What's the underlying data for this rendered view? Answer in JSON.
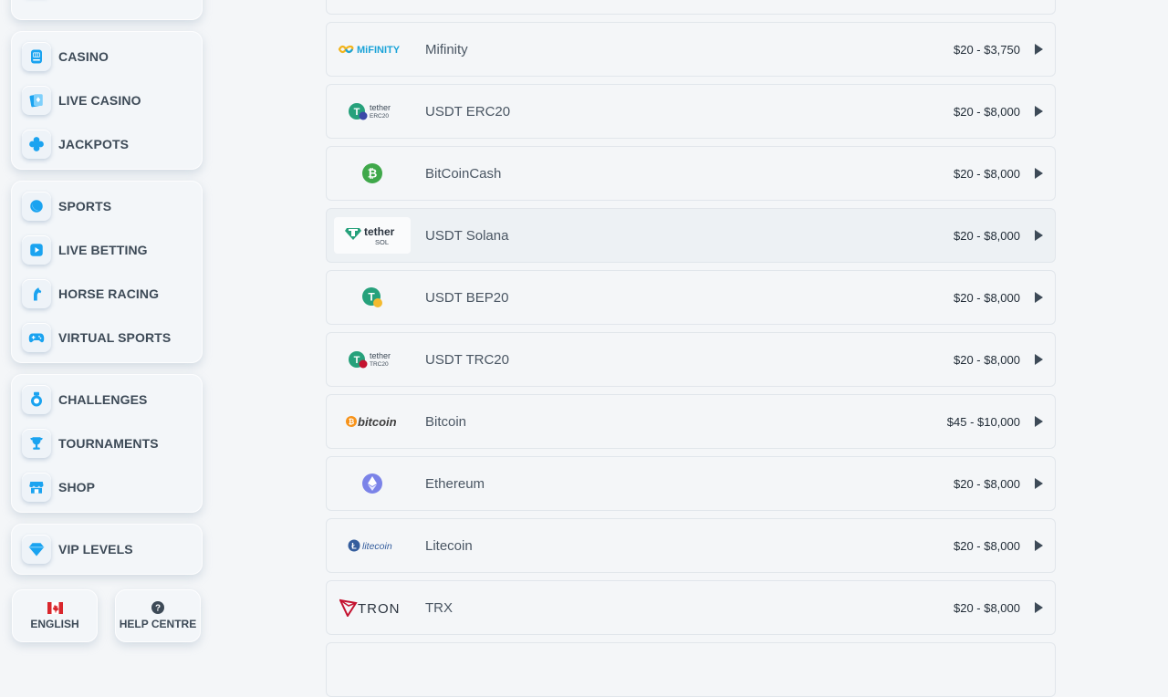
{
  "sidebar": {
    "items": [
      {
        "label": "CASINO",
        "icon": "casino-icon"
      },
      {
        "label": "LIVE CASINO",
        "icon": "live-casino-icon"
      },
      {
        "label": "JACKPOTS",
        "icon": "jackpots-icon"
      },
      {
        "label": "SPORTS",
        "icon": "sports-icon"
      },
      {
        "label": "LIVE BETTING",
        "icon": "live-betting-icon"
      },
      {
        "label": "HORSE RACING",
        "icon": "horse-racing-icon"
      },
      {
        "label": "VIRTUAL SPORTS",
        "icon": "virtual-sports-icon"
      },
      {
        "label": "CHALLENGES",
        "icon": "challenges-icon"
      },
      {
        "label": "TOURNAMENTS",
        "icon": "trophy-icon"
      },
      {
        "label": "SHOP",
        "icon": "shop-icon"
      },
      {
        "label": "VIP LEVELS",
        "icon": "diamond-icon"
      }
    ],
    "language_label": "ENGLISH",
    "help_label": "HELP CENTRE"
  },
  "payments": [
    {
      "name": "Mifinity",
      "range": "$20 - $3,750",
      "logo": "mifinity-logo",
      "logo_text": "MiFINITY"
    },
    {
      "name": "USDT ERC20",
      "range": "$20 - $8,000",
      "logo": "tether-erc20-logo",
      "logo_text": "tether",
      "logo_sub": "ERC20"
    },
    {
      "name": "BitCoinCash",
      "range": "$20 - $8,000",
      "logo": "bitcoincash-logo"
    },
    {
      "name": "USDT Solana",
      "range": "$20 - $8,000",
      "logo": "tether-sol-logo",
      "logo_text": "tether",
      "logo_sub": "SOL"
    },
    {
      "name": "USDT BEP20",
      "range": "$20 - $8,000",
      "logo": "tether-bep20-logo"
    },
    {
      "name": "USDT TRC20",
      "range": "$20 - $8,000",
      "logo": "tether-trc20-logo",
      "logo_text": "tether",
      "logo_sub": "TRC20"
    },
    {
      "name": "Bitcoin",
      "range": "$45 - $10,000",
      "logo": "bitcoin-logo",
      "logo_text": "bitcoin"
    },
    {
      "name": "Ethereum",
      "range": "$20 - $8,000",
      "logo": "ethereum-logo"
    },
    {
      "name": "Litecoin",
      "range": "$20 - $8,000",
      "logo": "litecoin-logo",
      "logo_text": "litecoin"
    },
    {
      "name": "TRX",
      "range": "$20 - $8,000",
      "logo": "tron-logo",
      "logo_text": "TRON"
    }
  ],
  "colors": {
    "accent": "#1aa3f0",
    "tether": "#26a17b",
    "bitcoincash": "#3fa84a",
    "bitcoin": "#f7931a",
    "ethereum": "#7b83e8",
    "litecoin": "#345d9d",
    "tron": "#c4122f",
    "mifinity": "#1aa3d8"
  }
}
